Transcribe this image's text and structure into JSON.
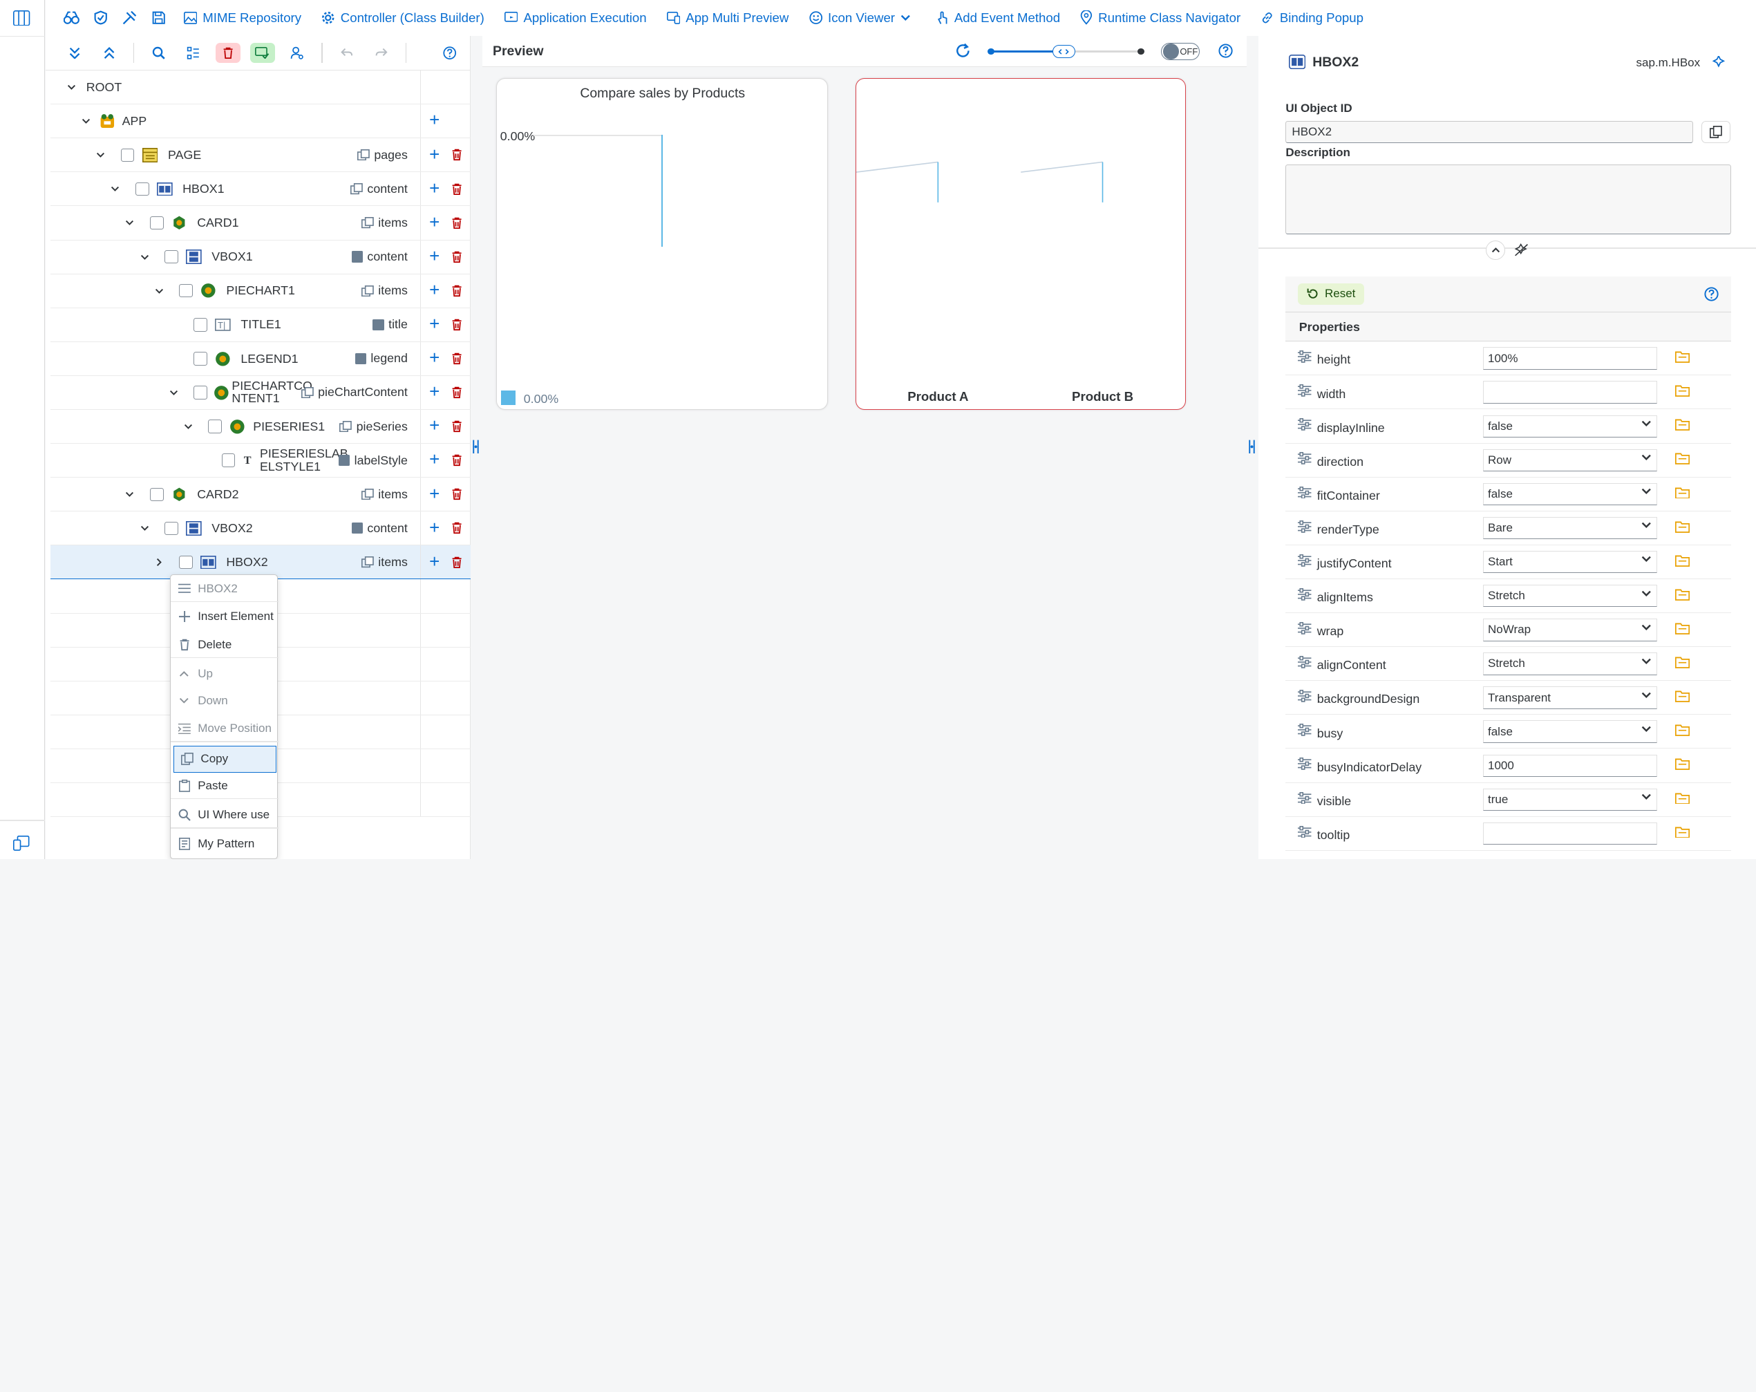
{
  "toolbar": {
    "items": [
      {
        "label": "MIME Repository",
        "icon": "image-icon"
      },
      {
        "label": "Controller (Class Builder)",
        "icon": "gear-icon"
      },
      {
        "label": "Application Execution",
        "icon": "monitor-icon"
      },
      {
        "label": "App Multi Preview",
        "icon": "devices-icon"
      },
      {
        "label": "Icon Viewer",
        "icon": "smiley-icon"
      },
      {
        "label": "Add Event Method",
        "icon": "touch-icon"
      },
      {
        "label": "Runtime Class Navigator",
        "icon": "location-icon"
      },
      {
        "label": "Binding Popup",
        "icon": "link-icon"
      }
    ]
  },
  "tree": {
    "rows": [
      {
        "label": "ROOT",
        "agg": ""
      },
      {
        "label": "APP",
        "agg": ""
      },
      {
        "label": "PAGE",
        "agg": "pages"
      },
      {
        "label": "HBOX1",
        "agg": "content"
      },
      {
        "label": "CARD1",
        "agg": "items"
      },
      {
        "label": "VBOX1",
        "agg": "content"
      },
      {
        "label": "PIECHART1",
        "agg": "items"
      },
      {
        "label": "TITLE1",
        "agg": "title"
      },
      {
        "label": "LEGEND1",
        "agg": "legend"
      },
      {
        "label": "PIECHARTCO",
        "label2": "NTENT1",
        "agg": "pieChartContent"
      },
      {
        "label": "PIESERIES1",
        "agg": "pieSeries"
      },
      {
        "label": "PIESERIESLAB",
        "label2": "ELSTYLE1",
        "agg": "labelStyle"
      },
      {
        "label": "CARD2",
        "agg": "items"
      },
      {
        "label": "VBOX2",
        "agg": "content"
      },
      {
        "label": "HBOX2",
        "agg": "items"
      }
    ]
  },
  "context_menu": {
    "header": "HBOX2",
    "items": [
      "Insert Element",
      "Delete",
      "Up",
      "Down",
      "Move Position",
      "Copy",
      "Paste",
      "UI Where use",
      "My Pattern"
    ]
  },
  "preview": {
    "title": "Preview",
    "toggle": "OFF",
    "card1": {
      "chart_title": "Compare sales by Products",
      "value_label": "0.00%",
      "legend_label": "0.00%"
    },
    "card2": {
      "labels": [
        "Product A",
        "Product B"
      ]
    }
  },
  "chart_data": [
    {
      "type": "pie",
      "title": "Compare sales by Products",
      "data_labels": [
        "0.00%"
      ],
      "legend": [
        "0.00%"
      ],
      "colors": [
        "#5cb8e6"
      ]
    },
    {
      "type": "line",
      "title": "",
      "categories": [
        "Product A",
        "Product B"
      ]
    }
  ],
  "details": {
    "name": "HBOX2",
    "class": "sap.m.HBox",
    "id_label": "UI Object ID",
    "id_value": "HBOX2",
    "desc_label": "Description",
    "reset": "Reset",
    "props_header": "Properties",
    "properties": [
      {
        "name": "height",
        "value": "100%",
        "type": "input"
      },
      {
        "name": "width",
        "value": "",
        "type": "input"
      },
      {
        "name": "displayInline",
        "value": "false",
        "type": "select"
      },
      {
        "name": "direction",
        "value": "Row",
        "type": "select"
      },
      {
        "name": "fitContainer",
        "value": "false",
        "type": "select"
      },
      {
        "name": "renderType",
        "value": "Bare",
        "type": "select"
      },
      {
        "name": "justifyContent",
        "value": "Start",
        "type": "select"
      },
      {
        "name": "alignItems",
        "value": "Stretch",
        "type": "select"
      },
      {
        "name": "wrap",
        "value": "NoWrap",
        "type": "select"
      },
      {
        "name": "alignContent",
        "value": "Stretch",
        "type": "select"
      },
      {
        "name": "backgroundDesign",
        "value": "Transparent",
        "type": "select"
      },
      {
        "name": "busy",
        "value": "false",
        "type": "select"
      },
      {
        "name": "busyIndicatorDelay",
        "value": "1000",
        "type": "input"
      },
      {
        "name": "visible",
        "value": "true",
        "type": "select"
      },
      {
        "name": "tooltip",
        "value": "",
        "type": "input"
      }
    ]
  },
  "colors": {
    "accent": "#0a6ed1",
    "delete": "#bb0000",
    "selected_row": "#e5f0fa",
    "card2_border": "#d8424a"
  }
}
